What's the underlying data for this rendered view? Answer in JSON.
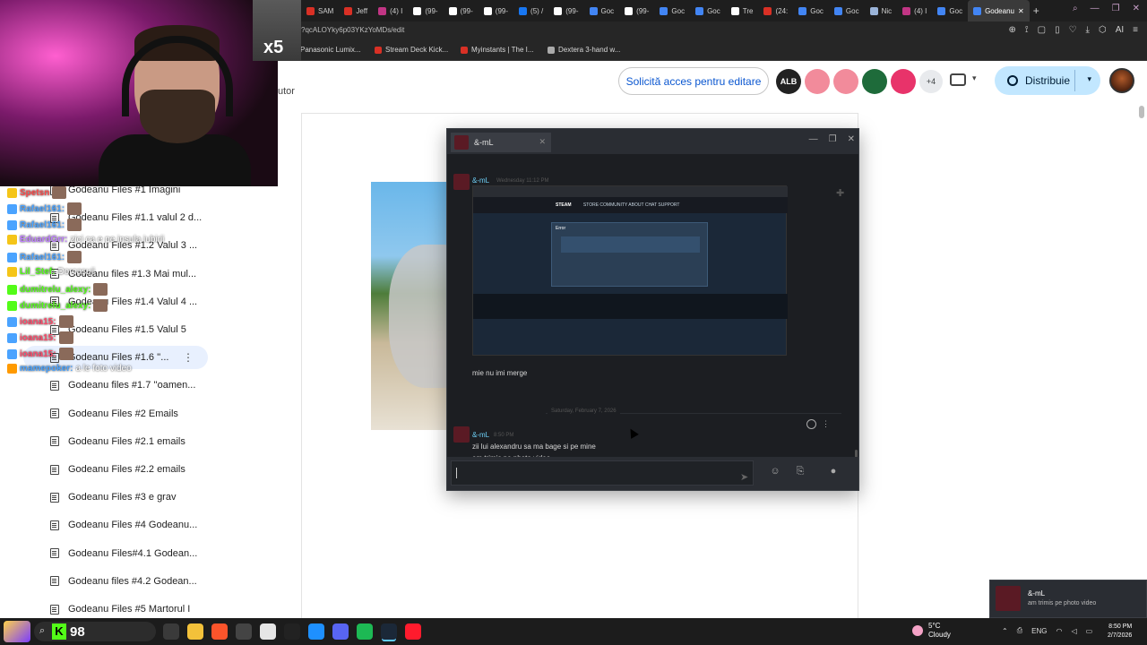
{
  "browser": {
    "tabs": [
      {
        "label": "SAM",
        "color": "#d93025"
      },
      {
        "label": "Jeff",
        "color": "#d93025"
      },
      {
        "label": "(4) I",
        "color": "#c13584"
      },
      {
        "label": "(99-",
        "color": "#ffffff"
      },
      {
        "label": "(99-",
        "color": "#ffffff"
      },
      {
        "label": "(99-",
        "color": "#ffffff"
      },
      {
        "label": "(5) /",
        "color": "#1877f2"
      },
      {
        "label": "(99-",
        "color": "#ffffff"
      },
      {
        "label": "Goc",
        "color": "#4285f4"
      },
      {
        "label": "(99-",
        "color": "#ffffff"
      },
      {
        "label": "Goc",
        "color": "#4285f4"
      },
      {
        "label": "Goc",
        "color": "#4285f4"
      },
      {
        "label": "Tre",
        "color": "#ffffff"
      },
      {
        "label": "(24:",
        "color": "#d93025"
      },
      {
        "label": "Goc",
        "color": "#4285f4"
      },
      {
        "label": "Goc",
        "color": "#4285f4"
      },
      {
        "label": "Nic",
        "color": "#9bb4d9"
      },
      {
        "label": "(4) I",
        "color": "#c13584"
      },
      {
        "label": "Goc",
        "color": "#4285f4"
      }
    ],
    "active_tab": {
      "label": "Godeanu",
      "color": "#4285f4"
    },
    "url": "?qcALOYky6p03YKzYoMDs/edit",
    "bookmarks": [
      {
        "label": "Panasonic Lumix...",
        "color": "#2b66c4"
      },
      {
        "label": "Stream Deck Kick...",
        "color": "#d93025"
      },
      {
        "label": "Myinstants | The I...",
        "color": "#d93025"
      },
      {
        "label": "Dextera 3-hand w...",
        "color": "#aaaaaa"
      }
    ]
  },
  "docs": {
    "request_edit": "Solicită acces pentru editare",
    "avatars": [
      {
        "initials": "ALB",
        "color": "#222222"
      },
      {
        "initials": "",
        "color": "#f28b9b"
      },
      {
        "initials": "",
        "color": "#f28b9b"
      },
      {
        "initials": "",
        "color": "#1e6b3a"
      },
      {
        "initials": "",
        "color": "#e8336a"
      }
    ],
    "more_count": "+4",
    "share": "Distribuie",
    "autor_fragment": "utor"
  },
  "outline": [
    {
      "label": "Godeanu Files #1 Imagini",
      "selected": false
    },
    {
      "label": "Godeanu Files #1.1 valul 2 d...",
      "selected": false
    },
    {
      "label": "Godeanu Files #1.2 Valul 3 ...",
      "selected": false
    },
    {
      "label": "Godeanu files #1.3 Mai mul...",
      "selected": false
    },
    {
      "label": "Godeanu Files #1.4 Valul 4 ...",
      "selected": false
    },
    {
      "label": "Godeanu Files #1.5 Valul 5",
      "selected": false
    },
    {
      "label": "Godeanu Files #1.6 ''...",
      "selected": true
    },
    {
      "label": "Godeanu files #1.7 ''oamen...",
      "selected": false
    },
    {
      "label": "Godeanu Files #2 Emails",
      "selected": false
    },
    {
      "label": "Godeanu Files #2.1 emails",
      "selected": false
    },
    {
      "label": "Godeanu Files #2.2 emails",
      "selected": false
    },
    {
      "label": "Godeanu Files #3 e grav",
      "selected": false
    },
    {
      "label": "Godeanu Files #4 Godeanu...",
      "selected": false
    },
    {
      "label": "Godeanu Files#4.1 Godean...",
      "selected": false
    },
    {
      "label": "Godeanu files #4.2 Godean...",
      "selected": false
    },
    {
      "label": "Godeanu Files #5 Martorul I",
      "selected": false
    }
  ],
  "stream_chat": [
    {
      "user": "Spetsn",
      "color": "#ff4a4a",
      "msg": ""
    },
    {
      "user": "Rafael161:",
      "color": "#4aa3ff",
      "msg": ""
    },
    {
      "user": "Rafael161:",
      "color": "#4aa3ff",
      "msg": ""
    },
    {
      "user": "EduardGrr:",
      "color": "#c080ff",
      "msg": "zici ca e pe insula iubirii"
    },
    {
      "user": "Rafael161:",
      "color": "#4aa3ff",
      "msg": ""
    },
    {
      "user": "Lil_Stef:",
      "color": "#53fc18",
      "msg": "Dorcasuji"
    },
    {
      "user": "dumitrelu_alexy:",
      "color": "#53fc18",
      "msg": ""
    },
    {
      "user": "dumitrelu_alexy:",
      "color": "#53fc18",
      "msg": ""
    },
    {
      "user": "ioana15:",
      "color": "#ff4a6a",
      "msg": ""
    },
    {
      "user": "ioana15:",
      "color": "#ff4a6a",
      "msg": ""
    },
    {
      "user": "ioana15:",
      "color": "#ff4a6a",
      "msg": ""
    },
    {
      "user": "mamepoker:",
      "color": "#4aa3ff",
      "msg": "a le foto video"
    }
  ],
  "webcam": {
    "multiplier": "x5"
  },
  "steam_chat": {
    "tab_name": "&-mL",
    "msg1_name": "&-mL",
    "msg1_time": "Wednesday 11:12 PM",
    "screenshot_nav": [
      "STORE",
      "COMMUNITY",
      "ABOUT",
      "CHAT",
      "SUPPORT"
    ],
    "screenshot_logo": "STEAM",
    "screenshot_error_title": "Error",
    "msg1_text": "mie nu imi merge",
    "date_divider": "Saturday, February 7, 2026",
    "msg2_name": "&-mL",
    "msg2_time": "8:50 PM",
    "msg2_line1": "zii lui alexandru sa ma bage si pe mine",
    "msg2_line2": "am trimis pe photo video"
  },
  "taskbar": {
    "kick_count": "98",
    "weather_temp": "5°C",
    "weather_desc": "Cloudy",
    "language": "ENG",
    "time": "8:50 PM",
    "date": "2/7/2026",
    "apps": [
      {
        "name": "task-view",
        "color": "#3a3a3a"
      },
      {
        "name": "file-explorer",
        "color": "#f3c13a"
      },
      {
        "name": "brave",
        "color": "#fb542b"
      },
      {
        "name": "obs",
        "color": "#444444"
      },
      {
        "name": "store",
        "color": "#e6e6e6"
      },
      {
        "name": "github",
        "color": "#222222"
      },
      {
        "name": "streamer-bot",
        "color": "#1e90ff"
      },
      {
        "name": "discord",
        "color": "#5865f2"
      },
      {
        "name": "spotify",
        "color": "#1db954"
      },
      {
        "name": "steam",
        "color": "#1b2838"
      },
      {
        "name": "opera-gx",
        "color": "#ff1b2d"
      }
    ]
  },
  "notification": {
    "name": "&-mL",
    "text": "am trimis pe photo video"
  }
}
